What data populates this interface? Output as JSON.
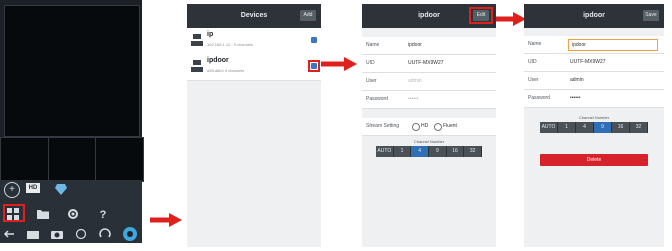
{
  "phone1": {
    "toolbar_top": [
      "add-icon",
      "hd-icon",
      "diamond-icon"
    ],
    "hd_label": "HD",
    "toolbar_mid": [
      "grid-icon",
      "folder-icon",
      "gear-icon",
      "help-icon"
    ],
    "help_label": "?",
    "toolbar_bottom": [
      "back-icon",
      "tray-icon",
      "camera-icon",
      "settings-icon",
      "rotate-icon",
      "ptz-icon"
    ]
  },
  "devices": {
    "title": "Devices",
    "add_button": "Add",
    "list": [
      {
        "name": "ip",
        "sub": "192.168.1.10 : 9 channels"
      },
      {
        "name": "ipdoor",
        "sub": "a5f1d8b4 9 channels"
      }
    ]
  },
  "edit": {
    "title": "ipdoor",
    "save_button": "Edit",
    "fields": [
      {
        "label": "Name",
        "value": "ipdoor",
        "placeholder": false
      },
      {
        "label": "UID",
        "value": "UUTF-MX9W27",
        "placeholder": false
      },
      {
        "label": "User",
        "value": "admin",
        "placeholder": true
      },
      {
        "label": "Password",
        "value": "••••••",
        "placeholder": true
      }
    ],
    "stream_label": "Stream Setting",
    "stream_options": [
      "HD",
      "Fluent"
    ],
    "channel_label": "Channel Number",
    "channels": [
      "AUTO",
      "1",
      "4",
      "9",
      "16",
      "32"
    ],
    "selected_channel": 2
  },
  "edit2": {
    "title": "ipdoor",
    "save_button": "Save",
    "fields": [
      {
        "label": "Name",
        "value": "ipdoor"
      },
      {
        "label": "UID",
        "value": "UUTF-MX9W27"
      },
      {
        "label": "User",
        "value": "admin"
      },
      {
        "label": "Password",
        "value": "••••••"
      }
    ],
    "channel_label": "Channel Number",
    "channels": [
      "AUTO",
      "1",
      "4",
      "9",
      "16",
      "32"
    ],
    "selected_channel": 3,
    "delete_button": "Delete"
  },
  "colors": {
    "accent_red": "#e0201c",
    "select_blue": "#2f6fb5",
    "delete_red": "#d6222a"
  }
}
